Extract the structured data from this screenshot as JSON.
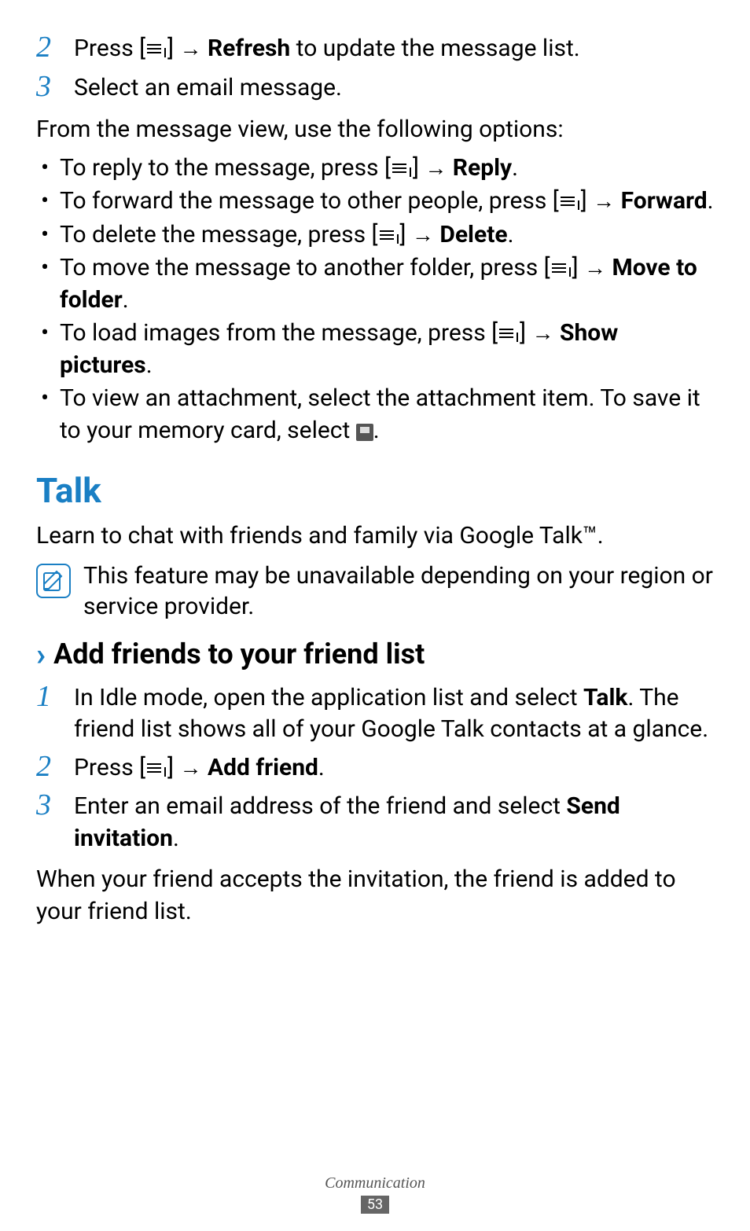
{
  "steps_top": [
    {
      "num": "2",
      "pre": "Press [",
      "post": "] ",
      "action": "Refresh",
      "tail": " to update the message list."
    },
    {
      "num": "3",
      "text": "Select an email message."
    }
  ],
  "intro_para": "From the message view, use the following options:",
  "bullets": [
    {
      "pre": "To reply to the message, press [",
      "post": "] ",
      "action": "Reply",
      "tail": "."
    },
    {
      "pre": "To forward the message to other people, press [",
      "post": "] ",
      "action": "Forward",
      "tail": "."
    },
    {
      "pre": "To delete the message, press [",
      "post": "] ",
      "action": "Delete",
      "tail": "."
    },
    {
      "pre": "To move the message to another folder, press [",
      "post": "] ",
      "action": "Move to folder",
      "tail": "."
    },
    {
      "pre": "To load images from the message, press [",
      "post": "] ",
      "action": "Show pictures",
      "tail": "."
    },
    {
      "plain_pre": "To view an attachment, select the attachment item. To save it to your memory card, select ",
      "save_icon": true,
      "plain_post": "."
    }
  ],
  "talk_heading": "Talk",
  "talk_intro": "Learn to chat with friends and family via Google Talk™.",
  "note": "This feature may be unavailable depending on your region or service provider.",
  "sub_heading": "Add friends to your friend list",
  "steps_bottom": [
    {
      "num": "1",
      "pre": "In Idle mode, open the application list and select ",
      "bold": "Talk",
      "post": ". The friend list shows all of your Google Talk contacts at a glance."
    },
    {
      "num": "2",
      "pre": "Press [",
      "menu_icon": true,
      "mid": "] ",
      "arrow": true,
      "bold": "Add friend",
      "post": "."
    },
    {
      "num": "3",
      "pre": "Enter an email address of the friend and select ",
      "bold": "Send invitation",
      "post": "."
    }
  ],
  "closing": "When your friend accepts the invitation, the friend is added to your friend list.",
  "footer_label": "Communication",
  "page_num": "53",
  "arrow_glyph": "→"
}
